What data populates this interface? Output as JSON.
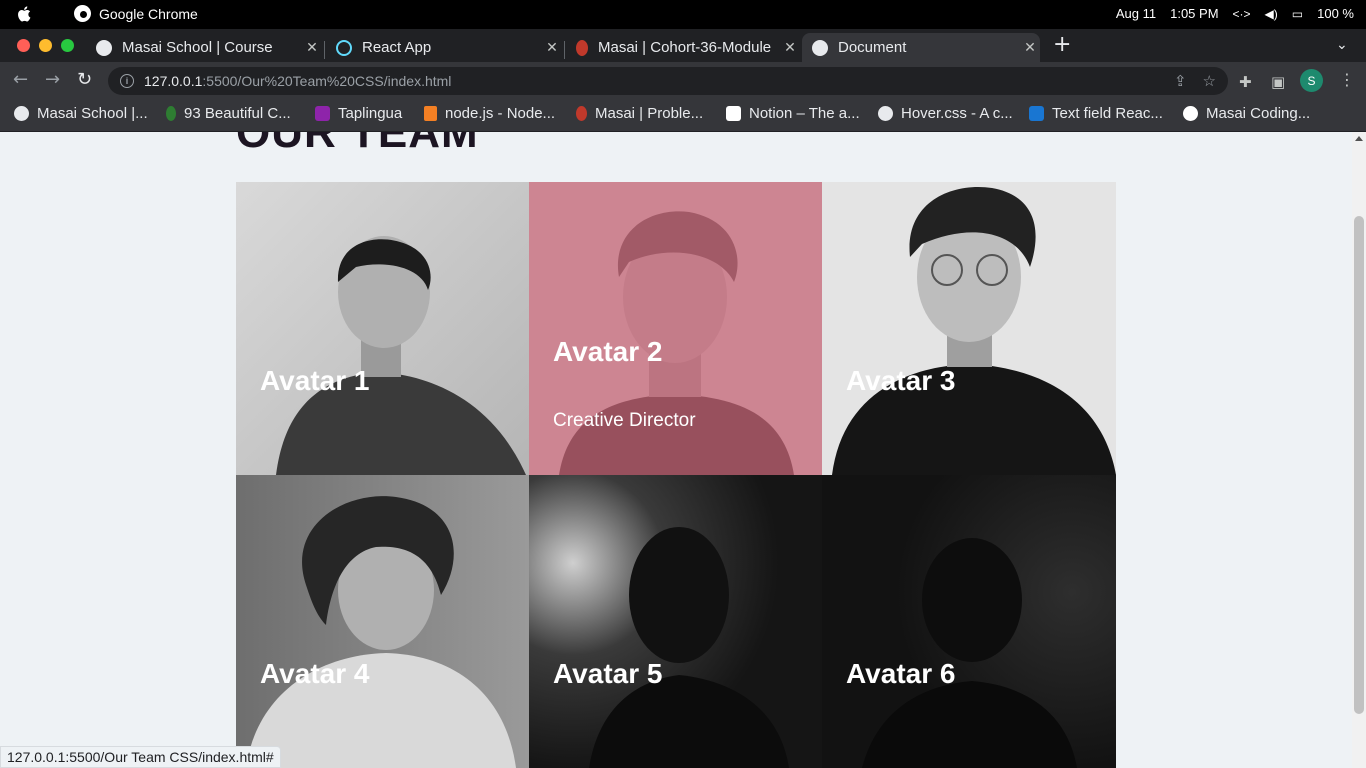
{
  "menubar": {
    "app_name": "Google Chrome",
    "date": "Aug 11",
    "time": "1:05 PM",
    "battery": "100 %"
  },
  "tabs": [
    {
      "title": "Masai School | Course",
      "active": false
    },
    {
      "title": "React App",
      "active": false
    },
    {
      "title": "Masai | Cohort-36-Module",
      "active": false
    },
    {
      "title": "Document",
      "active": true
    }
  ],
  "toolbar": {
    "url_host": "127.0.0.1",
    "url_path": ":5500/Our%20Team%20CSS/index.html",
    "profile_initial": "S"
  },
  "bookmarks": [
    {
      "label": "Masai School |..."
    },
    {
      "label": "93 Beautiful C..."
    },
    {
      "label": "Taplingua"
    },
    {
      "label": "node.js - Node..."
    },
    {
      "label": "Masai | Proble..."
    },
    {
      "label": "Notion – The a..."
    },
    {
      "label": "Hover.css - A c..."
    },
    {
      "label": "Text field Reac..."
    },
    {
      "label": "Masai Coding..."
    }
  ],
  "page": {
    "title": "OUR TEAM",
    "members": [
      {
        "name": "Avatar 1",
        "role": ""
      },
      {
        "name": "Avatar 2",
        "role": "Creative Director"
      },
      {
        "name": "Avatar 3",
        "role": ""
      },
      {
        "name": "Avatar 4",
        "role": ""
      },
      {
        "name": "Avatar 5",
        "role": ""
      },
      {
        "name": "Avatar 6",
        "role": ""
      }
    ]
  },
  "status_bar": {
    "text": "127.0.0.1:5500/Our Team CSS/index.html#"
  },
  "colors": {
    "hover_overlay": "#e64664",
    "page_background": "#eef2f5",
    "title_color": "#1c1522"
  }
}
